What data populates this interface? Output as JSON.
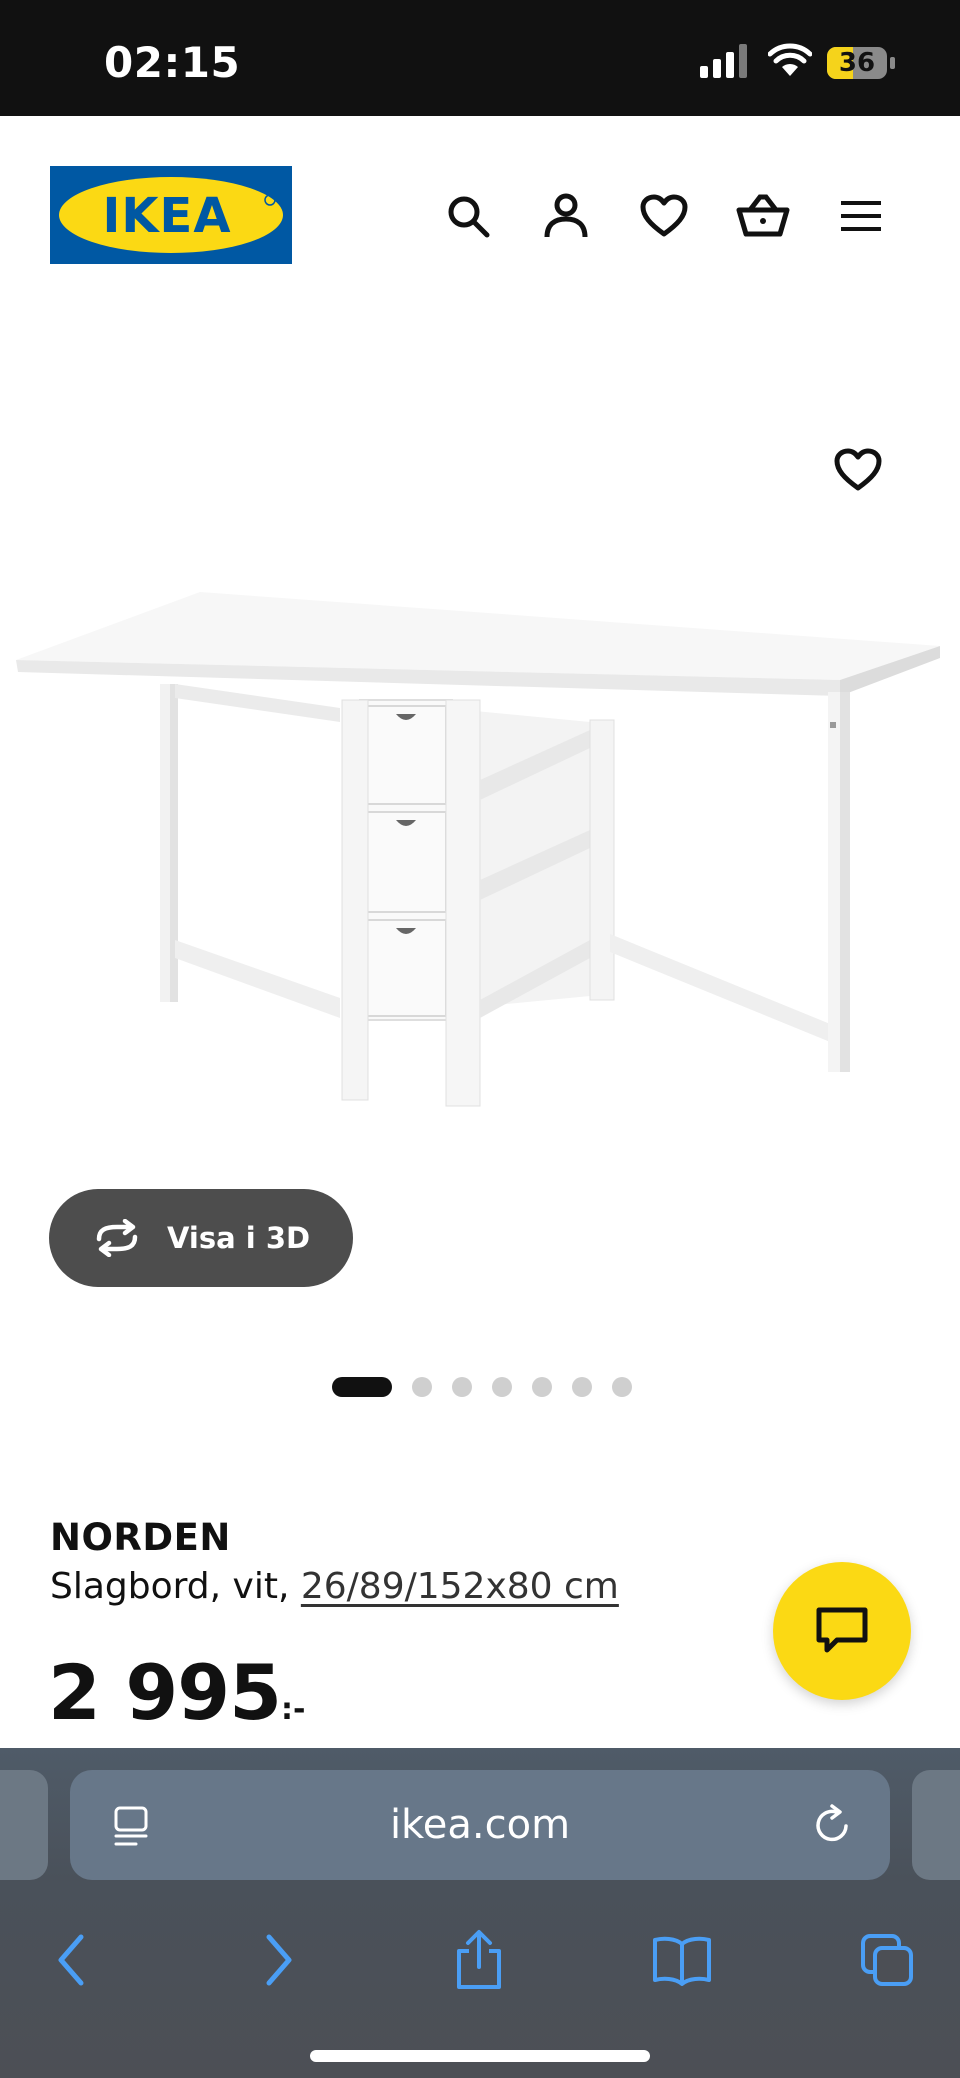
{
  "status_bar": {
    "time": "02:15",
    "battery": "36",
    "icons": [
      "signal-icon",
      "wifi-icon",
      "battery-icon"
    ]
  },
  "header": {
    "logo_text": "IKEA",
    "icons": [
      "search-icon",
      "account-icon",
      "heart-icon",
      "basket-icon",
      "menu-icon"
    ]
  },
  "gallery": {
    "view_3d_label": "Visa i 3D",
    "dots_total": 7,
    "active_dot": 1
  },
  "product": {
    "name": "NORDEN",
    "description": "Slagbord, vit, ",
    "measurements": "26/89/152x80 cm",
    "price": "2 995",
    "price_suffix": ":-"
  },
  "browser": {
    "url": "ikea.com",
    "icons": [
      "reader-icon",
      "reload-icon",
      "back-icon",
      "forward-icon",
      "share-icon",
      "bookmarks-icon",
      "tabs-icon"
    ]
  },
  "colors": {
    "brand_blue": "#0058a3",
    "brand_yellow": "#fbd914",
    "text": "#111111",
    "browser_bar": "#4f5b68",
    "browser_accent": "#4a9ef5"
  }
}
